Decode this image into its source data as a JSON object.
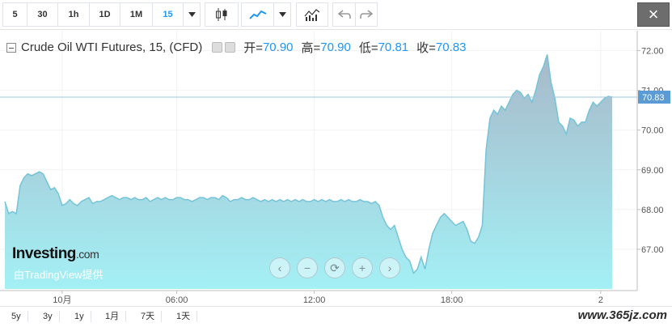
{
  "toolbar": {
    "intervals": [
      "5",
      "30",
      "1h",
      "1D",
      "1M",
      "15"
    ],
    "active_interval": "15",
    "close_label": "×"
  },
  "legend": {
    "symbol": "Crude Oil WTI Futures, 15, (CFD)",
    "open_label": "开=",
    "open_value": "70.90",
    "high_label": "高=",
    "high_value": "70.90",
    "low_label": "低=",
    "low_value": "70.81",
    "close_label": "收=",
    "close_value": "70.83"
  },
  "watermark": {
    "brand": "Investing",
    "brand_suffix": ".com",
    "provider": "由TradingView提供"
  },
  "site_watermark": "www.365jz.com",
  "ranges": [
    "5y",
    "3y",
    "1y",
    "1月",
    "7天",
    "1天"
  ],
  "colors": {
    "line": "#74c3d9",
    "fill_top": "#a8b9c9",
    "fill_bottom": "#a3f0f5",
    "price_label_bg": "#5b9bd5",
    "accent": "#2196f3"
  },
  "chart_data": {
    "type": "area",
    "y_ticks": [
      "72.00",
      "71.00",
      "70.00",
      "69.00",
      "68.00",
      "67.00"
    ],
    "y_tick_values": [
      72,
      71,
      70,
      69,
      68,
      67
    ],
    "ylim": [
      66.0,
      72.5
    ],
    "x_ticks": [
      "10月",
      "06:00",
      "12:00",
      "18:00",
      "2",
      "06:00"
    ],
    "x_tick_index": [
      15,
      45,
      81,
      117,
      156,
      186
    ],
    "last_price_label": "70.83",
    "last_price": 70.83,
    "values": [
      68.2,
      67.9,
      67.95,
      67.9,
      68.6,
      68.8,
      68.9,
      68.85,
      68.9,
      68.95,
      68.9,
      68.7,
      68.5,
      68.55,
      68.4,
      68.1,
      68.15,
      68.25,
      68.15,
      68.1,
      68.2,
      68.25,
      68.3,
      68.15,
      68.2,
      68.2,
      68.25,
      68.3,
      68.35,
      68.3,
      68.25,
      68.3,
      68.3,
      68.25,
      68.3,
      68.25,
      68.25,
      68.3,
      68.2,
      68.25,
      68.3,
      68.25,
      68.3,
      68.25,
      68.25,
      68.3,
      68.3,
      68.25,
      68.25,
      68.2,
      68.25,
      68.3,
      68.3,
      68.25,
      68.3,
      68.3,
      68.25,
      68.35,
      68.3,
      68.2,
      68.25,
      68.25,
      68.3,
      68.25,
      68.25,
      68.3,
      68.25,
      68.2,
      68.25,
      68.2,
      68.25,
      68.2,
      68.25,
      68.2,
      68.25,
      68.2,
      68.25,
      68.2,
      68.25,
      68.2,
      68.2,
      68.25,
      68.2,
      68.25,
      68.2,
      68.25,
      68.2,
      68.2,
      68.25,
      68.2,
      68.25,
      68.2,
      68.2,
      68.25,
      68.2,
      68.2,
      68.15,
      68.2,
      68.1,
      67.8,
      67.6,
      67.5,
      67.6,
      67.3,
      67.0,
      66.8,
      66.7,
      66.4,
      66.5,
      66.8,
      66.5,
      67.0,
      67.4,
      67.6,
      67.8,
      67.9,
      67.8,
      67.7,
      67.6,
      67.65,
      67.7,
      67.5,
      67.2,
      67.15,
      67.3,
      67.6,
      69.5,
      70.3,
      70.5,
      70.4,
      70.6,
      70.5,
      70.7,
      70.9,
      71.0,
      70.95,
      70.8,
      70.9,
      70.7,
      71.0,
      71.4,
      71.6,
      71.9,
      71.2,
      70.8,
      70.2,
      70.1,
      69.9,
      70.3,
      70.25,
      70.1,
      70.2,
      70.2,
      70.5,
      70.7,
      70.6,
      70.7,
      70.8,
      70.85,
      70.83
    ]
  }
}
